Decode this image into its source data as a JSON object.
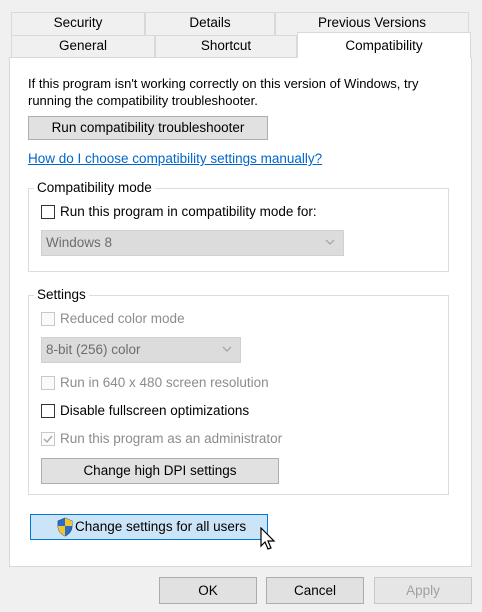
{
  "tabs_row1": [
    "Security",
    "Details",
    "Previous Versions"
  ],
  "tabs_row2": [
    "General",
    "Shortcut",
    "Compatibility"
  ],
  "intro_text": {
    "line1": "If this program isn't working correctly on this version of Windows, try",
    "line2": "running the compatibility troubleshooter."
  },
  "run_troubleshooter_label": "Run compatibility troubleshooter",
  "manual_link": "How do I choose compatibility settings manually?",
  "compat_mode": {
    "group_label": "Compatibility mode",
    "checkbox_label": "Run this program in compatibility mode for:",
    "checked": false,
    "select_value": "Windows 8"
  },
  "settings": {
    "group_label": "Settings",
    "reduced_color_label": "Reduced color mode",
    "color_select_value": "8-bit (256) color",
    "resolution_label": "Run in 640 x 480 screen resolution",
    "fullscreen_label": "Disable fullscreen optimizations",
    "fullscreen_checked": false,
    "admin_label": "Run this program as an administrator",
    "admin_checked": true,
    "dpi_button_label": "Change high DPI settings"
  },
  "all_users_button_label": "Change settings for all users",
  "footer": {
    "ok": "OK",
    "cancel": "Cancel",
    "apply": "Apply"
  },
  "colors": {
    "accent_link": "#0066cc",
    "selected_button_bg": "#cce4f7",
    "selected_button_border": "#0078d7"
  }
}
